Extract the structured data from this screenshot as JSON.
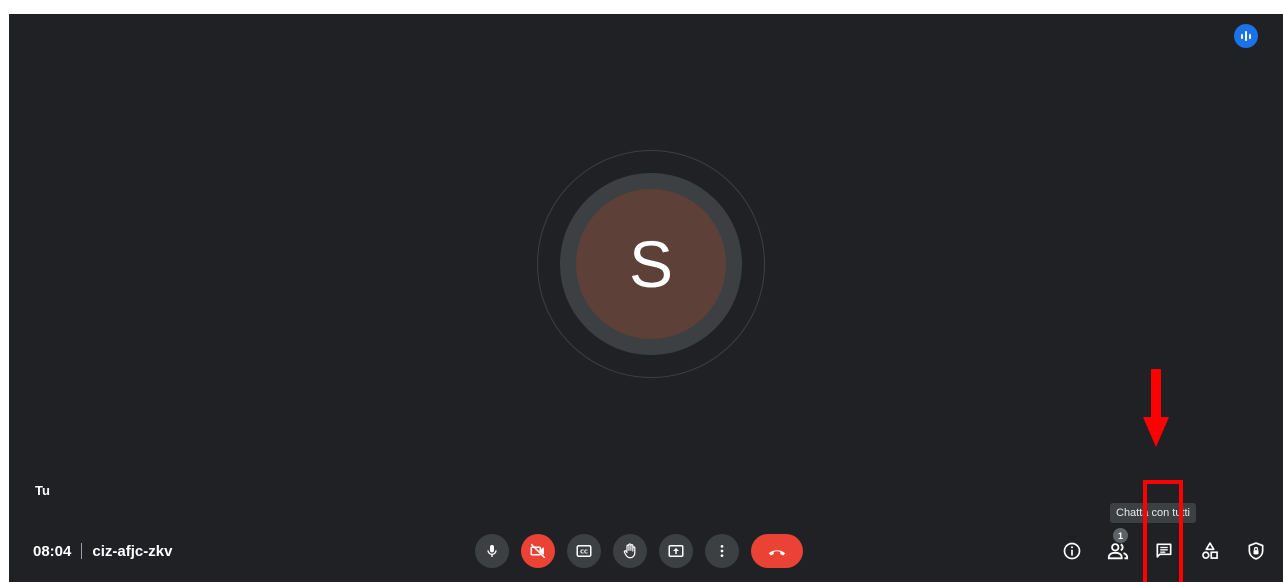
{
  "self_tile": {
    "initial": "S",
    "name_label": "Tu"
  },
  "meeting": {
    "time": "08:04",
    "code": "ciz-afjc-zkv"
  },
  "toolbar": {
    "participants_badge": "1"
  },
  "tooltip": {
    "text": "Chatta con tutti"
  },
  "colors": {
    "background": "#202124",
    "button": "#3c4043",
    "danger": "#ea4335",
    "avatar": "#5d4037",
    "accent": "#1a73e8",
    "annotation": "#ff0000"
  },
  "icons": {
    "speaker_indicator": "audio-bars-icon",
    "microphone": "microphone-icon",
    "camera_off": "video-off-icon",
    "captions": "captions-icon",
    "raise_hand": "hand-icon",
    "present": "present-screen-icon",
    "more": "more-vert-icon",
    "hangup": "call-end-icon",
    "info": "info-icon",
    "people": "people-icon",
    "chat": "chat-icon",
    "activities": "shapes-icon",
    "host_controls": "shield-lock-icon"
  }
}
